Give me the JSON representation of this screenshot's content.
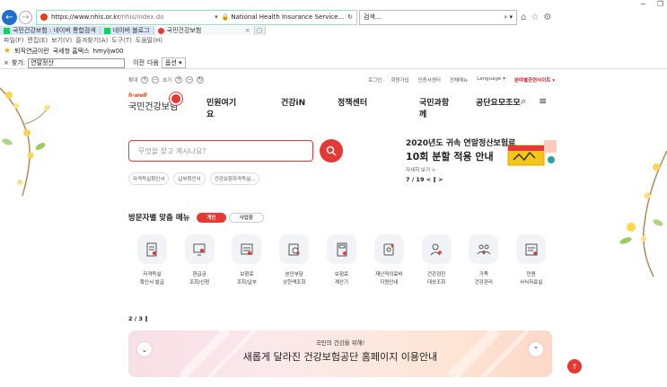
{
  "browser": {
    "url_host": "https://www.nhis.or.kr",
    "url_path": "/nhis/index.do",
    "site_identity": "National Health Insurance Service...",
    "search_placeholder": "검색...",
    "window_controls": [
      "−",
      "❐"
    ],
    "tabs": [
      {
        "label": "국민건강보험 : 네이버 통합검색",
        "active": false
      },
      {
        "label": "네이버 블로그",
        "active": false
      },
      {
        "label": "국민건강보험",
        "active": true
      }
    ],
    "menu": [
      "파일(F)",
      "편집(E)",
      "보기(V)",
      "즐겨찾기(A)",
      "도구(T)",
      "도움말(H)"
    ],
    "favorites": [
      "퇴직연금이란",
      "국세청 홈택스",
      "hmyljw00"
    ],
    "find": {
      "label": "찾기:",
      "value": "연말정산",
      "prev_label": "이전",
      "next_label": "다음",
      "options_label": "옵션 ▾",
      "close": "×"
    }
  },
  "topbar": {
    "font_label": "확대",
    "plus": "+",
    "minus": "−",
    "reset_label": "초기",
    "links": [
      "로그인",
      "회원가입",
      "인증서센터",
      "전체메뉴",
      "Language ▾",
      "분야별관련사이트 ▾"
    ]
  },
  "logo": {
    "brand_en": "h-well",
    "brand_kr": "국민건강보험"
  },
  "gnb": [
    "민원여기요",
    "건강iN",
    "정책센터",
    "국민과함께",
    "공단요모조모"
  ],
  "search": {
    "placeholder": "무엇을 찾고 계시나요?"
  },
  "quick_tags": [
    "자격득실확인서",
    "납부확인서",
    "건강보험자격득실..."
  ],
  "banner": {
    "title1": "2020년도 귀속 연말정산보험료",
    "title2": "10회 분할 적용 안내",
    "more": "자세히 보기 >",
    "pager": "7 / 19  <  ‖  >"
  },
  "visit": {
    "title": "방문자별 맞춤 메뉴",
    "tab_on": "개인",
    "tab_off": "사업장"
  },
  "services": [
    {
      "icon": "document-icon",
      "line1": "자격득실",
      "line2": "확인서 발급"
    },
    {
      "icon": "monitor-icon",
      "line1": "환급금",
      "line2": "조회/신청"
    },
    {
      "icon": "calculator-icon",
      "line1": "보험료",
      "line2": "조회/납부"
    },
    {
      "icon": "search-document-icon",
      "line1": "본인부담",
      "line2": "상한액조회"
    },
    {
      "icon": "calculator-doc-icon",
      "line1": "보험료",
      "line2": "계산기"
    },
    {
      "icon": "tablet-icon",
      "line1": "재난적의료비",
      "line2": "지원안내"
    },
    {
      "icon": "person-search-icon",
      "line1": "건강검진",
      "line2": "대상조회"
    },
    {
      "icon": "family-icon",
      "line1": "가족",
      "line2": "건강관리"
    },
    {
      "icon": "form-icon",
      "line1": "민원",
      "line2": "서식자료실"
    }
  ],
  "pager2": "2 / 3  ‖",
  "bottom_banner": {
    "sub": "국민의 건강을 위해!",
    "main": "새롭게 달라진 건강보험공단 홈페이지 이용안내"
  },
  "colors": {
    "accent": "#e53935",
    "link_blue": "#1e6fd0"
  }
}
